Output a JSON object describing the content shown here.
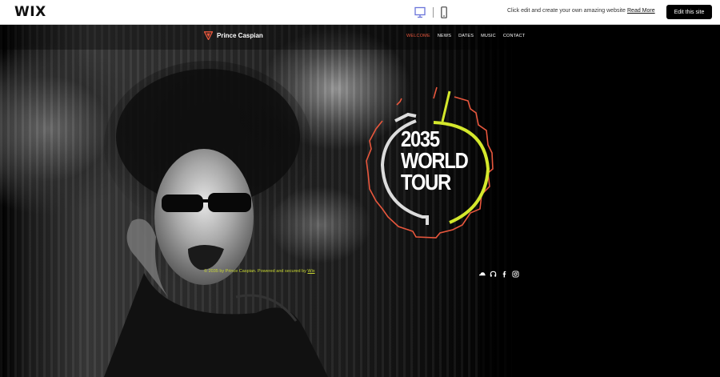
{
  "wix_bar": {
    "logo": "WIX",
    "desktop_icon": "desktop-icon",
    "mobile_icon": "mobile-icon",
    "promo_text": "Click edit and create your own amazing website",
    "read_more": "Read More",
    "edit_button": "Edit this site"
  },
  "site": {
    "brand_name": "Prince Caspian",
    "nav": [
      "WELCOME",
      "NEWS",
      "DATES",
      "MUSIC",
      "CONTACT"
    ],
    "active_nav": "WELCOME",
    "hero_title_lines": [
      "2035",
      "WORLD",
      "TOUR"
    ],
    "footer": {
      "prefix": "© 2035 by Prince Caspian. Powered and secured by ",
      "link": "Wix"
    },
    "social_icons": [
      "soundcloud-icon",
      "headphones-icon",
      "facebook-icon",
      "instagram-icon"
    ]
  },
  "colors": {
    "accent_red": "#e8573d",
    "accent_lime": "#d4e82c",
    "ring_gray": "#dcdcdc",
    "footer_text": "#c9d832"
  }
}
